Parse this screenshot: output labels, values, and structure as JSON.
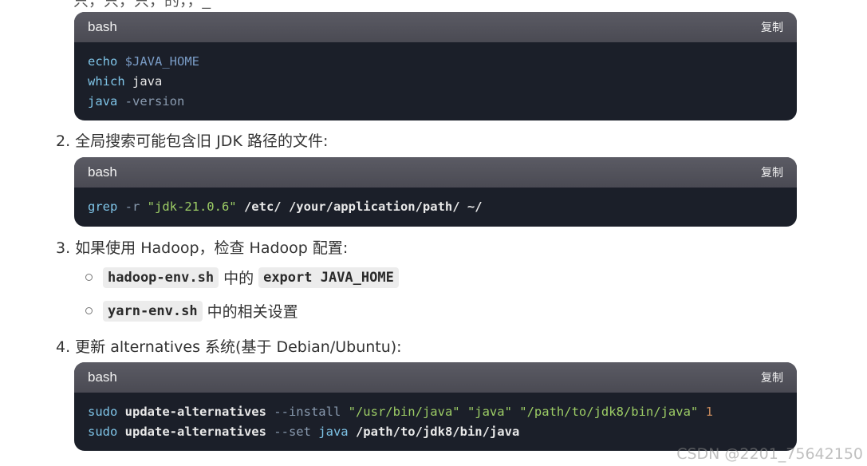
{
  "top_partial_text": "只，只，只，的，，_",
  "copy_label": "复制",
  "blocks": [
    {
      "lang": "bash",
      "lines": [
        [
          {
            "t": "echo",
            "c": "kw"
          },
          {
            "t": " $JAVA_HOME",
            "c": "var"
          }
        ],
        [
          {
            "t": "which",
            "c": "kw"
          },
          {
            "t": " java",
            "c": "arg"
          }
        ],
        [
          {
            "t": "java",
            "c": "kw"
          },
          {
            "t": " -version",
            "c": "op"
          }
        ]
      ]
    },
    {
      "lang": "bash",
      "lines": [
        [
          {
            "t": "grep",
            "c": "kw"
          },
          {
            "t": " -r ",
            "c": "op"
          },
          {
            "t": "\"jdk-21.0.6\"",
            "c": "str"
          },
          {
            "t": " /etc/ /your/application/path/ ~/",
            "c": "cmd"
          }
        ]
      ]
    },
    {
      "lang": "bash",
      "lines": [
        [
          {
            "t": "sudo",
            "c": "kw"
          },
          {
            "t": " update-alternatives",
            "c": "cmd"
          },
          {
            "t": " --install",
            "c": "op"
          },
          {
            "t": " \"/usr/bin/java\"",
            "c": "str"
          },
          {
            "t": " \"java\"",
            "c": "str"
          },
          {
            "t": " \"/path/to/jdk8/bin/java\"",
            "c": "str"
          },
          {
            "t": " 1",
            "c": "num"
          }
        ],
        [
          {
            "t": "sudo",
            "c": "kw"
          },
          {
            "t": " update-alternatives",
            "c": "cmd"
          },
          {
            "t": " --set",
            "c": "op"
          },
          {
            "t": " java",
            "c": "kw"
          },
          {
            "t": " /path/to/jdk8/bin/java",
            "c": "cmd"
          }
        ]
      ]
    }
  ],
  "steps": {
    "step2": "2. 全局搜索可能包含旧 JDK 路径的文件:",
    "step3": "3. 如果使用 Hadoop，检查 Hadoop 配置:",
    "step4": "4. 更新 alternatives 系统(基于 Debian/Ubuntu):"
  },
  "sub_items": {
    "item1_code1": "hadoop-env.sh",
    "item1_text": "中的",
    "item1_code2": "export JAVA_HOME",
    "item2_code": "yarn-env.sh",
    "item2_text": "中的相关设置"
  },
  "watermark": "CSDN @2201_75642150"
}
